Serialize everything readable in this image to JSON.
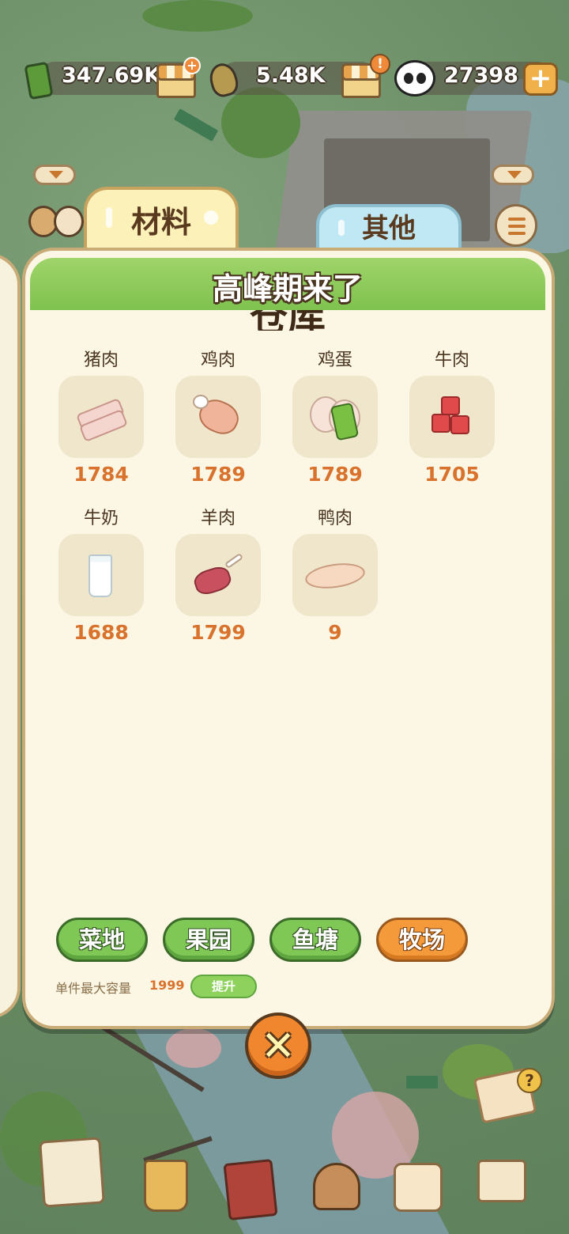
{
  "resources": {
    "bamboo": "347.69K",
    "shoots": "5.48K",
    "pandas": "27398",
    "shop_plus_badge": "+",
    "shop_alert_badge": "!",
    "add_symbol": "+"
  },
  "tabs": [
    {
      "label": "材料",
      "active": true
    },
    {
      "label": "其他",
      "active": false
    }
  ],
  "panel": {
    "banner": "高峰期来了",
    "title_partial": "仓库"
  },
  "items": [
    {
      "name": "猪肉",
      "count": "1784",
      "icon": "pork-icon"
    },
    {
      "name": "鸡肉",
      "count": "1789",
      "icon": "chicken-leg-icon"
    },
    {
      "name": "鸡蛋",
      "count": "1789",
      "icon": "egg-icon"
    },
    {
      "name": "牛肉",
      "count": "1705",
      "icon": "beef-icon"
    },
    {
      "name": "牛奶",
      "count": "1688",
      "icon": "milk-icon"
    },
    {
      "name": "羊肉",
      "count": "1799",
      "icon": "lamb-icon"
    },
    {
      "name": "鸭肉",
      "count": "9",
      "icon": "duck-icon"
    }
  ],
  "categories": [
    {
      "label": "菜地",
      "active": false
    },
    {
      "label": "果园",
      "active": false
    },
    {
      "label": "鱼塘",
      "active": false
    },
    {
      "label": "牧场",
      "active": true
    }
  ],
  "capacity": {
    "label": "单件最大容量",
    "value": "1999",
    "upgrade_label": "提升"
  },
  "close_symbol": "✕",
  "colors": {
    "accent_orange": "#f49a3a",
    "accent_green": "#7fc855",
    "count_orange": "#d9722c",
    "panel_bg": "#fbf7e4"
  }
}
